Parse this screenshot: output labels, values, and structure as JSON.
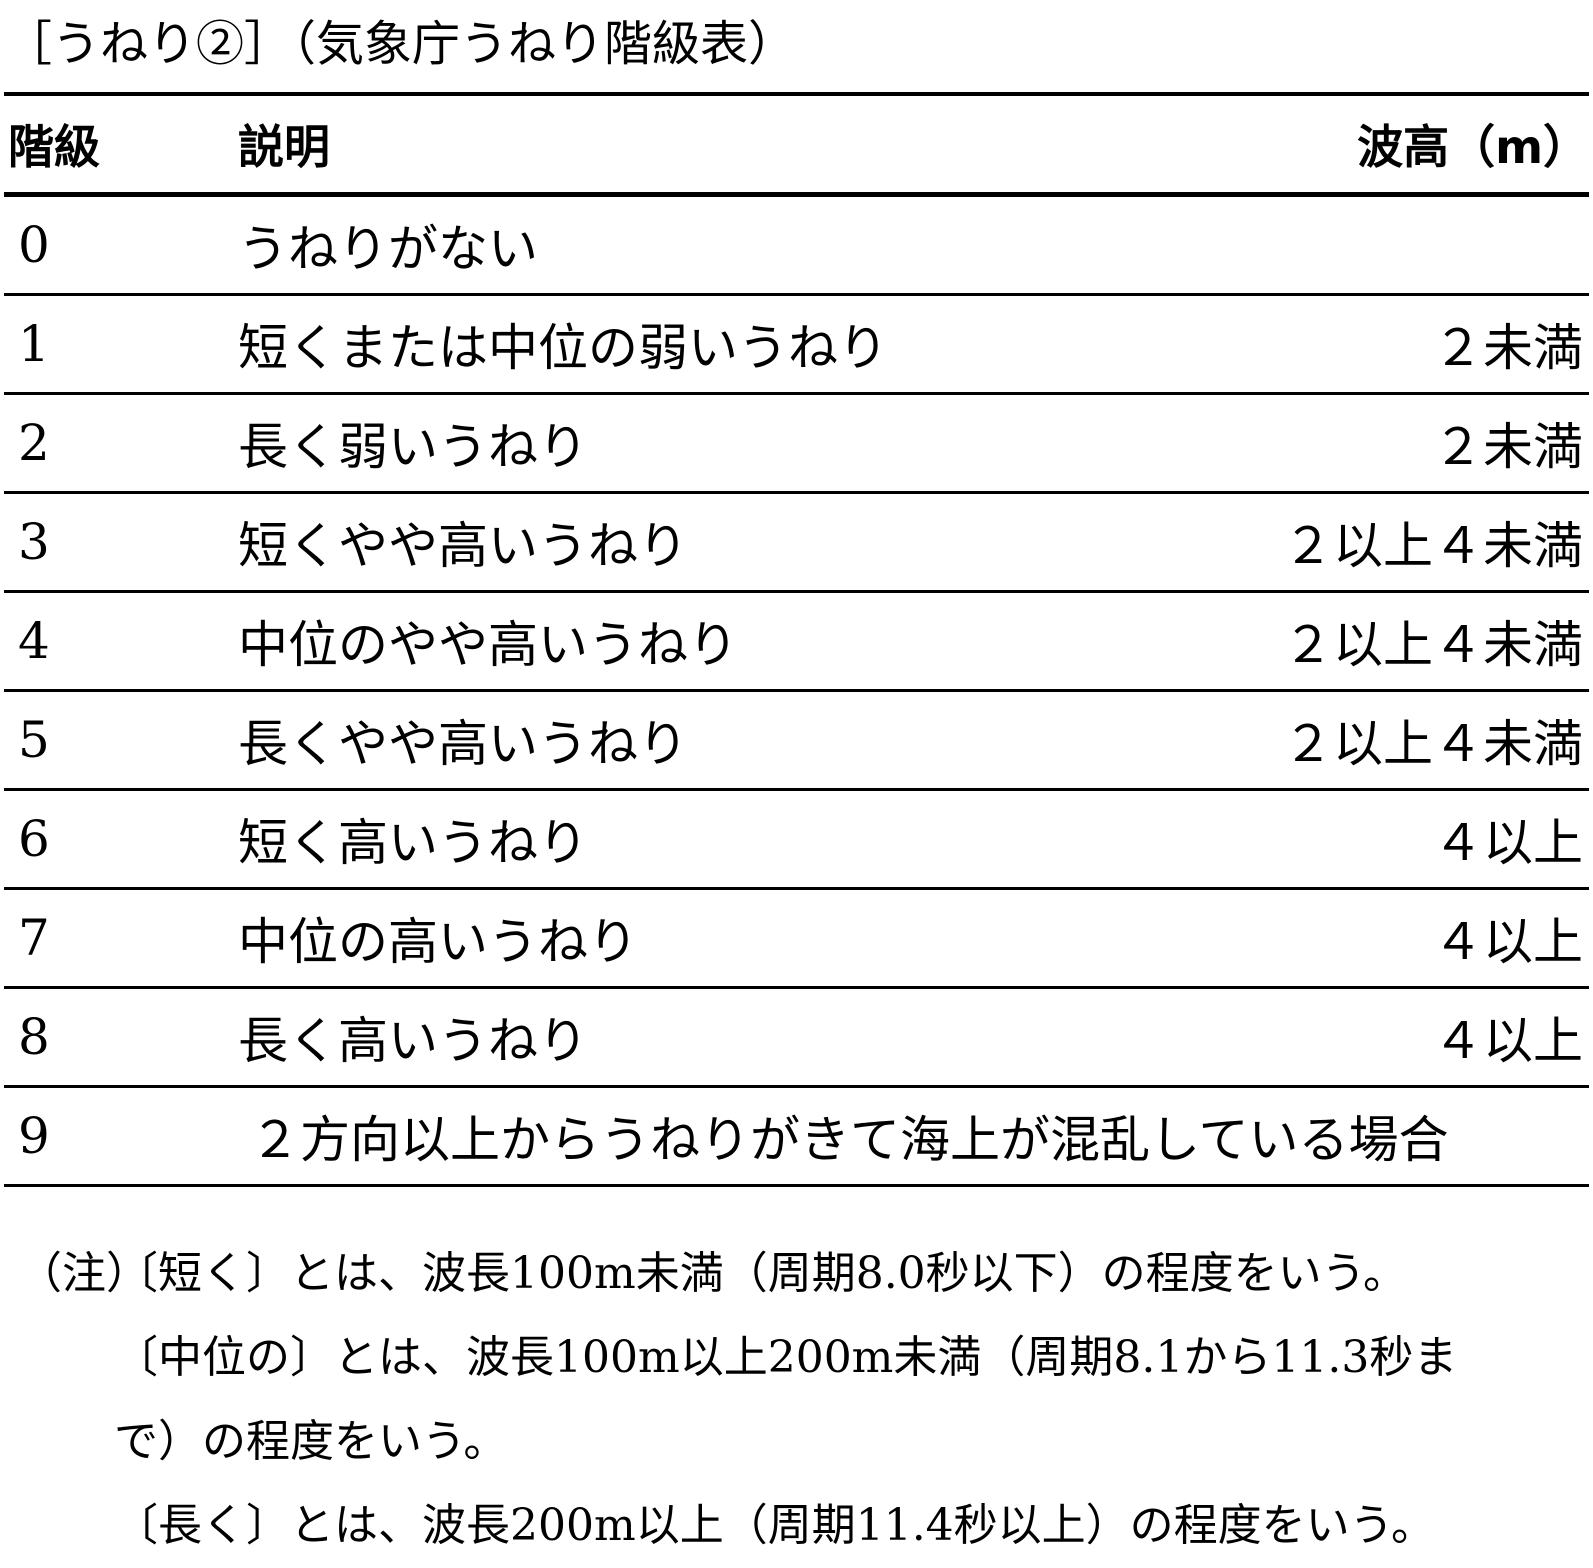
{
  "title": "［うねり②］（気象庁うねり階級表）",
  "table": {
    "headers": {
      "level": "階級",
      "description": "説明",
      "wave_height": "波高（m）"
    },
    "rows": [
      {
        "level": "0",
        "description": "うねりがない",
        "wave_height": ""
      },
      {
        "level": "1",
        "description": "短くまたは中位の弱いうねり",
        "wave_height": "２未満"
      },
      {
        "level": "2",
        "description": "長く弱いうねり",
        "wave_height": "２未満"
      },
      {
        "level": "3",
        "description": "短くやや高いうねり",
        "wave_height": "２以上４未満"
      },
      {
        "level": "4",
        "description": "中位のやや高いうねり",
        "wave_height": "２以上４未満"
      },
      {
        "level": "5",
        "description": "長くやや高いうねり",
        "wave_height": "２以上４未満"
      },
      {
        "level": "6",
        "description": "短く高いうねり",
        "wave_height": "４以上"
      },
      {
        "level": "7",
        "description": "中位の高いうねり",
        "wave_height": "４以上"
      },
      {
        "level": "8",
        "description": "長く高いうねり",
        "wave_height": "４以上"
      },
      {
        "level": "9",
        "description": "２方向以上からうねりがきて海上が混乱している場合",
        "wave_height": ""
      }
    ]
  },
  "notes": {
    "prefix": "（注）",
    "short": "〔短く〕とは、波長100m未満（周期8.0秒以下）の程度をいう。",
    "medium_line1": "〔中位の〕とは、波長100m以上200m未満（周期8.1から11.3秒ま",
    "medium_line2": "で）の程度をいう。",
    "long": "〔長く〕とは、波長200m以上（周期11.4秒以上）の程度をいう。"
  }
}
